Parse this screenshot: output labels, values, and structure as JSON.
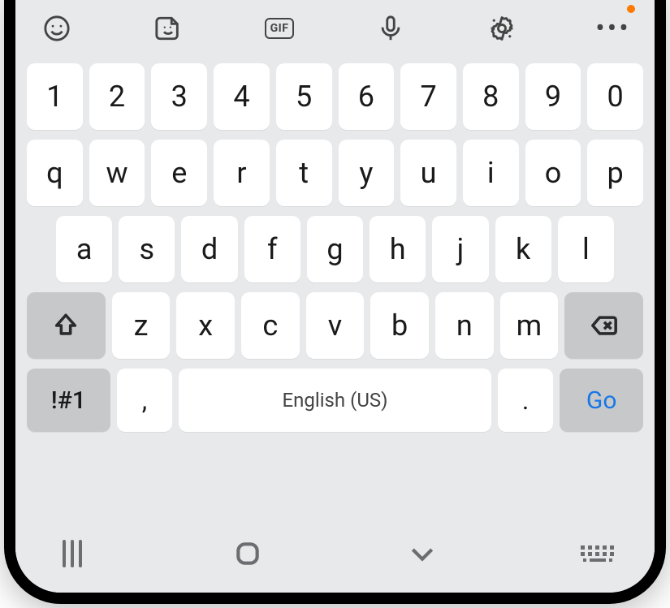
{
  "toolbar": {
    "icons": {
      "emoji": "emoji-icon",
      "sticker": "sticker-icon",
      "gif": "GIF",
      "voice": "mic-icon",
      "settings": "gear-icon",
      "more": "more-icon"
    },
    "notification_color": "#ff7a00"
  },
  "rows": {
    "numbers": [
      "1",
      "2",
      "3",
      "4",
      "5",
      "6",
      "7",
      "8",
      "9",
      "0"
    ],
    "row2": [
      "q",
      "w",
      "e",
      "r",
      "t",
      "y",
      "u",
      "i",
      "o",
      "p"
    ],
    "row3": [
      "a",
      "s",
      "d",
      "f",
      "g",
      "h",
      "j",
      "k",
      "l"
    ],
    "row4": [
      "z",
      "x",
      "c",
      "v",
      "b",
      "n",
      "m"
    ]
  },
  "fn": {
    "shift": "shift",
    "backspace": "backspace",
    "sym": "!#1",
    "comma": ",",
    "space": "English (US)",
    "period": ".",
    "go": "Go"
  },
  "nav": {
    "recents": "recents",
    "home": "home",
    "back": "back",
    "hide_keyboard": "hide-keyboard"
  },
  "colors": {
    "key_bg": "#ffffff",
    "fn_bg": "#c7c8ca",
    "panel_bg": "#e8e9eb",
    "go_color": "#1877e6"
  }
}
